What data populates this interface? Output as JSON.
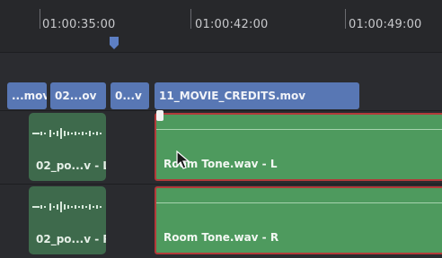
{
  "ruler": {
    "timecodes": [
      "01:00:35:00",
      "01:00:42:00",
      "01:00:49:00"
    ]
  },
  "video_track": {
    "clips": [
      {
        "label": "...mov"
      },
      {
        "label": "02...ov"
      },
      {
        "label": "0...v"
      },
      {
        "label": "11_MOVIE_CREDITS.mov"
      }
    ]
  },
  "audio_tracks": [
    {
      "small_clip_label": "02_po...v - L",
      "big_clip_label": "Room Tone.wav - L"
    },
    {
      "small_clip_label": "02_po...v - R",
      "big_clip_label": "Room Tone.wav - R"
    }
  ],
  "colors": {
    "video_clip": "#5877b4",
    "audio_clip": "#4e9a5e",
    "selected_border": "#b23a3a",
    "playhead": "#5d7fc4"
  }
}
